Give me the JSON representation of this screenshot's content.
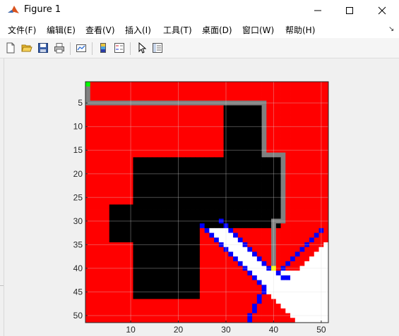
{
  "window": {
    "title": "Figure 1"
  },
  "window_buttons": [
    "minimize-icon",
    "maximize-icon",
    "close-icon"
  ],
  "menu": [
    {
      "label": "文件(F)"
    },
    {
      "label": "编辑(E)"
    },
    {
      "label": "查看(V)"
    },
    {
      "label": "插入(I)"
    },
    {
      "label": "工具(T)"
    },
    {
      "label": "桌面(D)"
    },
    {
      "label": "窗口(W)"
    },
    {
      "label": "帮助(H)"
    }
  ],
  "menu_overflow_icon": "overflow-arrow-icon",
  "toolbar": {
    "buttons": [
      "new-figure-icon",
      "open-file-icon",
      "save-icon",
      "print-icon",
      "link-plot-icon",
      "insert-colorbar-icon",
      "insert-legend-icon",
      "edit-plot-arrow-icon",
      "property-inspector-icon"
    ]
  },
  "colors": {
    "free": "#ff0000",
    "obstacle": "#000000",
    "unexplored": "#ffffff",
    "path": "#808080",
    "frontier": "#0000ff",
    "start": "#00ff00",
    "goal": "#ffff00",
    "grid": "#d9d9d9"
  },
  "chart_data": {
    "type": "heatmap",
    "title": "",
    "xlabel": "",
    "ylabel": "",
    "xlim": [
      0.5,
      51.5
    ],
    "ylim": [
      51.5,
      0.5
    ],
    "y_reversed": true,
    "grid": true,
    "xticks": [
      10,
      20,
      30,
      40,
      50
    ],
    "yticks": [
      5,
      10,
      15,
      20,
      25,
      30,
      35,
      40,
      45,
      50
    ],
    "legend": "none",
    "obstacle_rects": [
      {
        "cols": [
          30,
          37
        ],
        "rows": [
          6,
          16
        ]
      },
      {
        "cols": [
          11,
          41
        ],
        "rows": [
          17,
          31
        ]
      },
      {
        "cols": [
          6,
          10
        ],
        "rows": [
          27,
          34
        ]
      },
      {
        "cols": [
          11,
          24
        ],
        "rows": [
          32,
          46
        ]
      }
    ],
    "unexplored_regions": [
      {
        "rows": [
          31,
          51
        ],
        "polygon_cols_at_top": [
          25,
          29
        ],
        "description_free": "triangle left"
      },
      {
        "rows": [
          35,
          51
        ],
        "v_shape_apex": [
          42,
          41
        ]
      }
    ],
    "path": [
      [
        1,
        5
      ],
      [
        38,
        5
      ],
      [
        38,
        16
      ],
      [
        42,
        16
      ],
      [
        42,
        30
      ],
      [
        40,
        30
      ],
      [
        40,
        40
      ]
    ],
    "start": [
      1,
      1
    ],
    "goal": [
      40,
      40
    ],
    "frontier_lines": [
      {
        "from": [
          29,
          30
        ],
        "to": [
          39,
          40
        ]
      },
      {
        "from": [
          25,
          31
        ],
        "to": [
          38,
          44
        ]
      },
      {
        "from": [
          38,
          44
        ],
        "to": [
          35,
          51
        ]
      },
      {
        "from": [
          41,
          41
        ],
        "to": [
          51,
          34
        ]
      },
      {
        "from": [
          43,
          42
        ],
        "to": [
          42,
          42
        ]
      }
    ]
  }
}
